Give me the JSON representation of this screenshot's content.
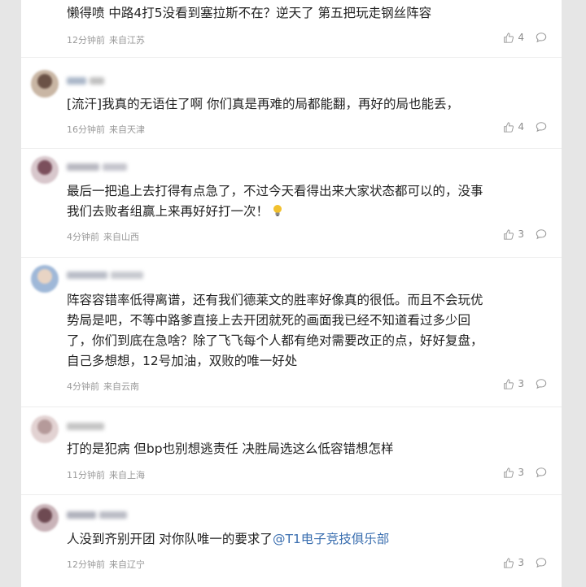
{
  "comments": [
    {
      "text": "懒得喷 中路4打5没看到塞拉斯不在？逆天了 第五把玩走钢丝阵容",
      "time": "12分钟前",
      "location": "来自江苏",
      "likes": "4"
    },
    {
      "text": "[流汗]我真的无语住了啊 你们真是再难的局都能翻，再好的局也能丢，",
      "time": "16分钟前",
      "location": "来自天津",
      "likes": "4"
    },
    {
      "text_lines": [
        "最后一把追上去打得有点急了，不过今天看得出来大家状态都可以的，没事",
        "我们去败者组赢上来再好好打一次！"
      ],
      "time": "4分钟前",
      "location": "来自山西",
      "likes": "3"
    },
    {
      "text_lines": [
        "阵容容错率低得离谱，还有我们德莱文的胜率好像真的很低。而且不会玩优",
        "势局是吧，不等中路爹直接上去开团就死的画面我已经不知道看过多少回",
        "了，你们到底在急啥？除了飞飞每个人都有绝对需要改正的点，好好复盘，",
        "自己多想想，12号加油，双败的唯一好处"
      ],
      "time": "4分钟前",
      "location": "来自云南",
      "likes": "3"
    },
    {
      "text": "打的是犯病 但bp也别想逃责任 决胜局选这么低容错想怎样",
      "time": "11分钟前",
      "location": "来自上海",
      "likes": "3"
    },
    {
      "text": "人没到齐别开团 对你队唯一的要求了",
      "mention": "@T1电子竞技俱乐部",
      "time": "12分钟前",
      "location": "来自辽宁",
      "likes": "3"
    }
  ],
  "colors": {
    "text": "#222222",
    "meta": "#9a9a9a",
    "mention": "#3b6fb0",
    "background": "#e6e6e6",
    "panel": "#ffffff"
  },
  "icons": {
    "like": "thumbs-up-icon",
    "reply": "comment-bubble-icon"
  }
}
